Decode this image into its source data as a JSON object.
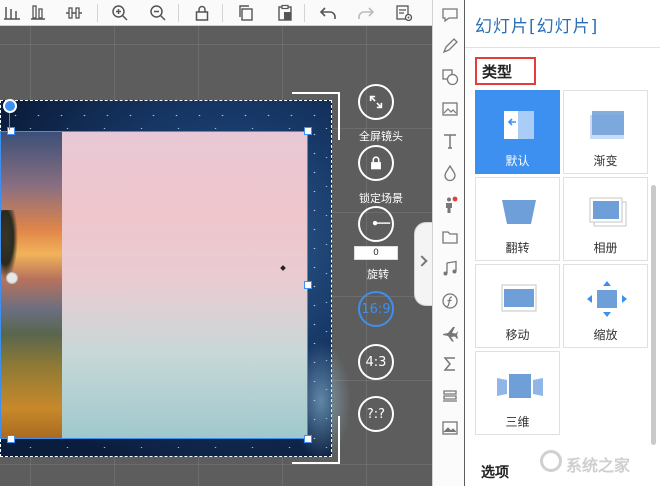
{
  "toolbar": {
    "buttons": [
      {
        "name": "align-bottom-icon"
      },
      {
        "name": "distribute-horizontal-icon"
      },
      {
        "name": "zoom-in-icon"
      },
      {
        "name": "zoom-out-icon"
      },
      {
        "name": "lock-icon"
      },
      {
        "name": "copy-icon"
      },
      {
        "name": "paste-icon"
      },
      {
        "name": "undo-icon"
      },
      {
        "name": "redo-icon"
      },
      {
        "name": "settings-icon"
      }
    ]
  },
  "canvas": {
    "controls": {
      "fullscreen_label": "全屏镜头",
      "lock_label": "锁定场景",
      "rotate_label": "旋转",
      "rotate_value": "0",
      "ratio_169": "16:9",
      "ratio_43": "4:3",
      "ratio_custom": "?:?"
    }
  },
  "panel": {
    "title": "幻灯片[幻灯片]",
    "section_label": "类型",
    "tiles": [
      {
        "label": "默认",
        "active": true
      },
      {
        "label": "渐变"
      },
      {
        "label": "翻转"
      },
      {
        "label": "相册"
      },
      {
        "label": "移动"
      },
      {
        "label": "缩放"
      },
      {
        "label": "三维"
      }
    ],
    "next_section_label": "选项"
  },
  "watermark": {
    "text": "系统之家"
  },
  "colors": {
    "accent": "#3d8ff0",
    "title": "#2c6fb6",
    "highlight_border": "#e53c3c",
    "notification_dot": "#e53c3c"
  }
}
